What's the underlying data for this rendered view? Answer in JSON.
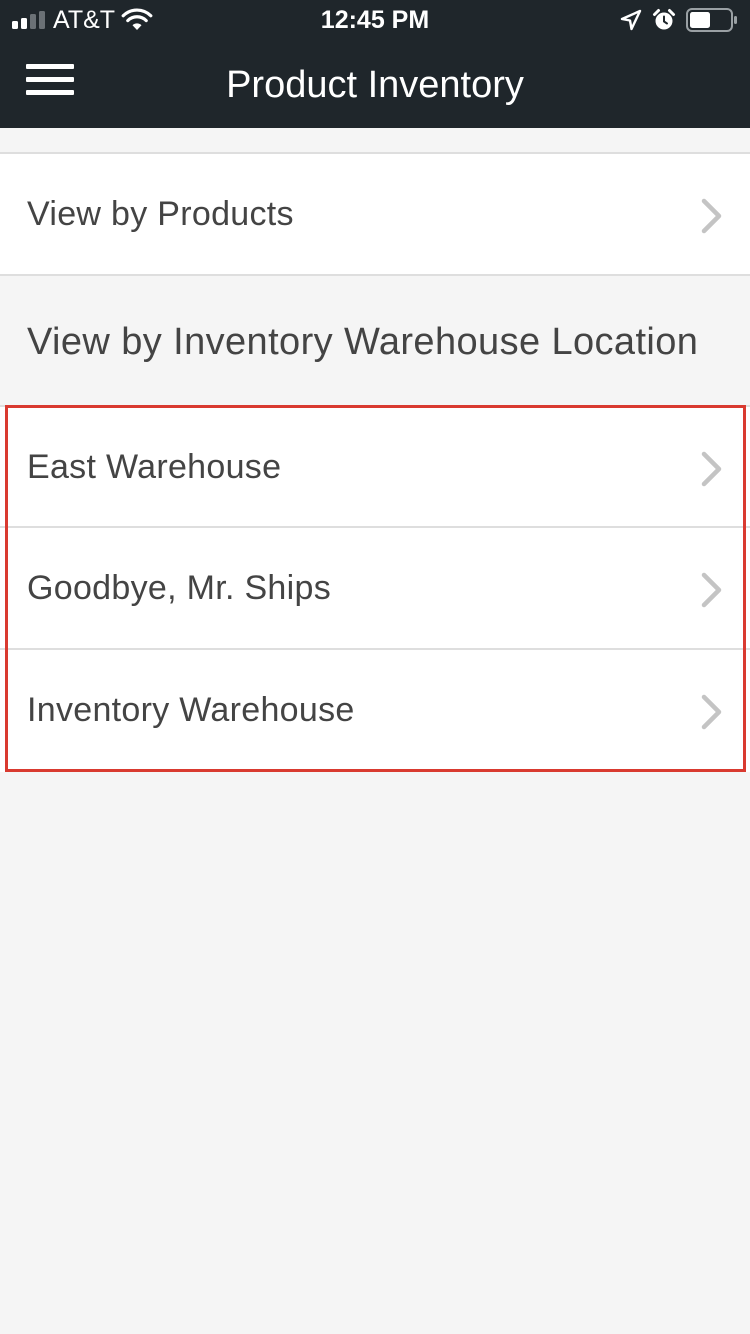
{
  "status_bar": {
    "carrier": "AT&T",
    "time": "12:45 PM",
    "battery_level_percent": 50,
    "icons": [
      "signal-icon",
      "wifi-icon",
      "location-arrow-icon",
      "alarm-icon",
      "battery-icon"
    ]
  },
  "header": {
    "title": "Product Inventory",
    "menu_icon": "hamburger-menu-icon",
    "background_color": "#1f262b"
  },
  "view_by_products": {
    "label": "View by Products"
  },
  "warehouse_section": {
    "title": "View by Inventory Warehouse Location",
    "items": [
      {
        "label": "East Warehouse"
      },
      {
        "label": "Goodbye, Mr. Ships"
      },
      {
        "label": "Inventory Warehouse"
      }
    ],
    "highlight_color": "#d93a30"
  }
}
